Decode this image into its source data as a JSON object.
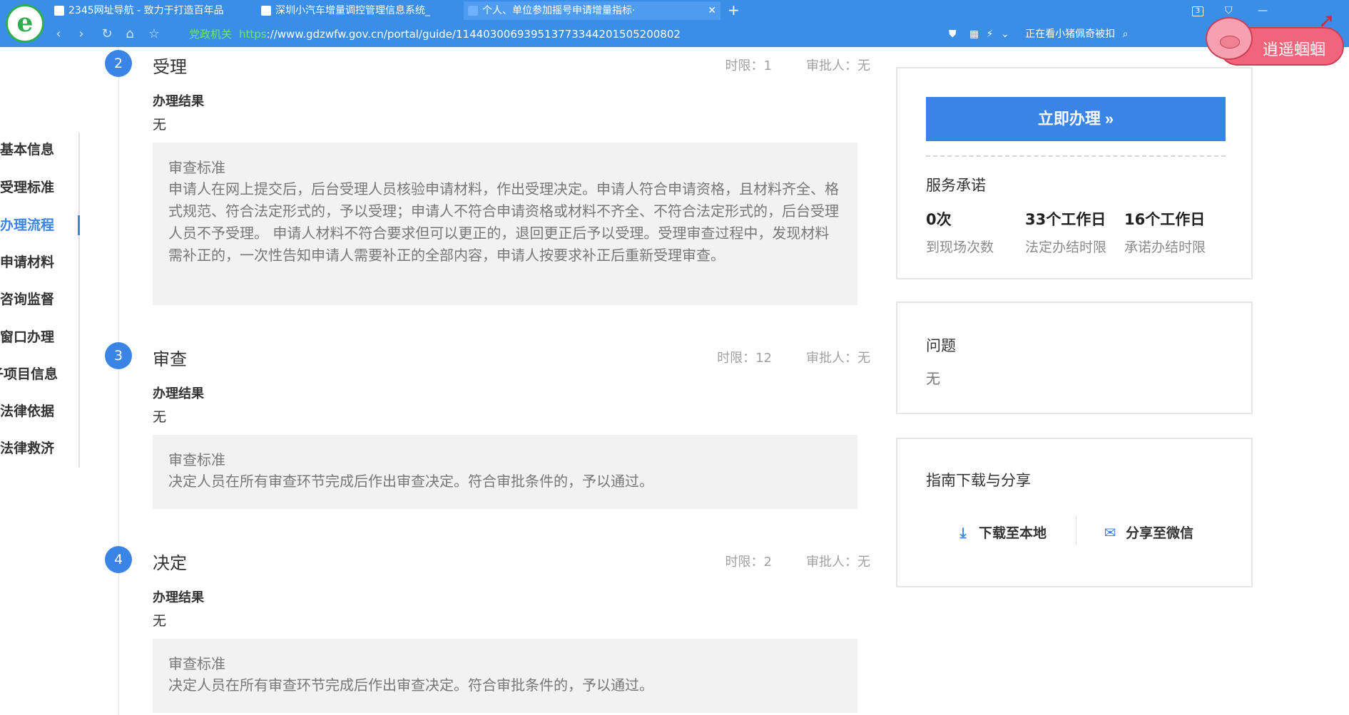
{
  "browser": {
    "tabs": [
      {
        "title": "2345网址导航 - 致力于打造百年品",
        "active": false
      },
      {
        "title": "深圳小汽车增量调控管理信息系统_",
        "active": false
      },
      {
        "title": "个人、单位参加摇号申请增量指标·",
        "active": true
      }
    ],
    "tab_counter": "3",
    "gov_badge": "党政机关",
    "url_scheme": "https",
    "url_rest": "://www.gdzwfw.gov.cn/portal/guide/11440300693951377334420150520080​2",
    "now_watching": "正在看小猪佩奇被扣",
    "mascot_text": "逍遥蝈蝈"
  },
  "leftnav": {
    "items": [
      {
        "label": "基本信息",
        "active": false
      },
      {
        "label": "受理标准",
        "active": false
      },
      {
        "label": "办理流程",
        "active": true
      },
      {
        "label": "申请材料",
        "active": false
      },
      {
        "label": "咨询监督",
        "active": false
      },
      {
        "label": "窗口办理",
        "active": false
      },
      {
        "label": "子项目信息",
        "active": false
      },
      {
        "label": "法律依据",
        "active": false
      },
      {
        "label": "法律救济",
        "active": false
      }
    ]
  },
  "steps": [
    {
      "num": "2",
      "title": "受理",
      "time_limit": "时限：1",
      "approver": "审批人：无",
      "result_label": "办理结果",
      "result_value": "无",
      "std_title": "审查标准",
      "std_text": "申请人在网上提交后，后台受理人员核验申请材料，作出受理决定。申请人符合申请资格，且材料齐全、格式规范、符合法定形式的，予以受理；申请人不符合申请资格或材料不齐全、不符合法定形式的，后台受理人员不予受理。 申请人材料不符合要求但可以更正的，退回更正后予以受理。受理审查过程中，发现材料需补正的，一次性告知申请人需要补正的全部内容，申请人按要求补正后重新受理审查。"
    },
    {
      "num": "3",
      "title": "审查",
      "time_limit": "时限：12",
      "approver": "审批人：无",
      "result_label": "办理结果",
      "result_value": "无",
      "std_title": "审查标准",
      "std_text": "决定人员在所有审查环节完成后作出审查决定。符合审批条件的，予以通过。"
    },
    {
      "num": "4",
      "title": "决定",
      "time_limit": "时限：2",
      "approver": "审批人：无",
      "result_label": "办理结果",
      "result_value": "无",
      "std_title": "审查标准",
      "std_text": "决定人员在所有审查环节完成后作出审查决定。符合审批条件的，予以通过。"
    }
  ],
  "service": {
    "apply_label": "立即办理 »",
    "promise_title": "服务承诺",
    "stats": [
      {
        "value": "0次",
        "label": "到现场次数"
      },
      {
        "value": "33个工作日",
        "label": "法定办结时限"
      },
      {
        "value": "16个工作日",
        "label": "承诺办结时限"
      }
    ]
  },
  "question": {
    "title": "问题",
    "value": "无"
  },
  "guide": {
    "title": "指南下载与分享",
    "download_label": "下载至本地",
    "wechat_label": "分享至微信"
  }
}
